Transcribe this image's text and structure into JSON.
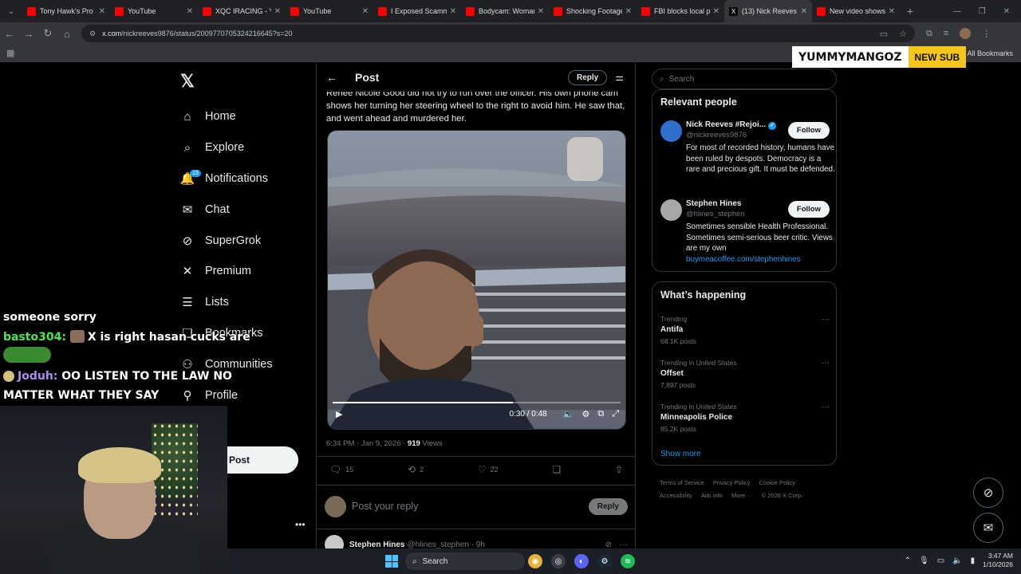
{
  "browser": {
    "tabs": [
      {
        "title": "Tony Hawk's Pro S",
        "icon": "youtube-icon"
      },
      {
        "title": "YouTube",
        "icon": "youtube-icon"
      },
      {
        "title": "XQC IRACING - Y",
        "icon": "youtube-icon"
      },
      {
        "title": "YouTube",
        "icon": "youtube-icon"
      },
      {
        "title": "I Exposed Scamm",
        "icon": "youtube-icon"
      },
      {
        "title": "Bodycam: Woman",
        "icon": "youtube-icon"
      },
      {
        "title": "Shocking Footage",
        "icon": "youtube-icon"
      },
      {
        "title": "FBI blocks local p",
        "icon": "youtube-icon"
      },
      {
        "title": "(13) Nick Reeves",
        "icon": "x-icon",
        "active": true
      },
      {
        "title": "New video shows",
        "icon": "youtube-icon"
      }
    ],
    "url_host": "x.com",
    "url_path": "/nickreeves9876/status/2009770705324216645?s=20",
    "all_bookmarks": "All Bookmarks"
  },
  "overlay": {
    "sub_name": "YUMMYMANGOZ",
    "sub_tag": "NEW SUB"
  },
  "nav": {
    "items": [
      {
        "label": "Home",
        "icon": "home-icon",
        "glyph": "⌂"
      },
      {
        "label": "Explore",
        "icon": "search-icon",
        "glyph": "⌕"
      },
      {
        "label": "Notifications",
        "icon": "bell-icon",
        "glyph": "🔔",
        "badge": "13"
      },
      {
        "label": "Chat",
        "icon": "mail-icon",
        "glyph": "✉"
      },
      {
        "label": "SuperGrok",
        "icon": "grok-icon",
        "glyph": "⊘"
      },
      {
        "label": "Premium",
        "icon": "x-icon",
        "glyph": "✕"
      },
      {
        "label": "Lists",
        "icon": "list-icon",
        "glyph": "☰"
      },
      {
        "label": "Bookmarks",
        "icon": "bookmark-icon",
        "glyph": "❏"
      },
      {
        "label": "Communities",
        "icon": "people-icon",
        "glyph": "⚇"
      },
      {
        "label": "Profile",
        "icon": "person-icon",
        "glyph": "⚲"
      }
    ],
    "post_label": "Post"
  },
  "post": {
    "header_title": "Post",
    "reply_label": "Reply",
    "text": "Renee Nicole Good did not try to run over the officer. His own phone cam shows her turning her steering wheel to the right to avoid him. He saw that, and went ahead and murdered her.",
    "video": {
      "time": "0:30 / 0:48",
      "progress": 0.625
    },
    "timestamp": "6:34 PM · Jan 9, 2026 · ",
    "views_count": "919",
    "views_label": " Views",
    "replies": "15",
    "reposts": "2",
    "likes": "22",
    "reply_placeholder": "Post your reply",
    "reply_button": "Reply",
    "next_reply": {
      "name": "Stephen Hines",
      "handle": "@hlines_stephen · 9h"
    }
  },
  "sidebar": {
    "search_placeholder": "Search",
    "relevant_title": "Relevant people",
    "people": [
      {
        "name": "Nick Reeves #Rejoi...",
        "handle": "@nickreeves9876",
        "bio": "For most of recorded history, humans have been ruled by despots. Democracy is a rare and precious gift. It must be defended.",
        "follow": "Follow",
        "verified": true
      },
      {
        "name": "Stephen Hines",
        "handle": "@hlines_stephen",
        "bio": "Sometimes sensible Health Professional. Sometimes semi-serious beer critic. Views are my own",
        "link": "buymeacoffee.com/stephenhines",
        "follow": "Follow"
      }
    ],
    "happening_title": "What’s happening",
    "trends": [
      {
        "context": "Trending",
        "title": "Antifa",
        "count": "68.1K posts"
      },
      {
        "context": "Trending in United States",
        "title": "Offset",
        "count": "7,897 posts"
      },
      {
        "context": "Trending in United States",
        "title": "Minneapolis Police",
        "count": "85.2K posts"
      }
    ],
    "show_more": "Show more",
    "footer": [
      "Terms of Service",
      "Privacy Policy",
      "Cookie Policy",
      "Accessibility",
      "Ads info",
      "More ···",
      "© 2026 X Corp."
    ]
  },
  "chat": {
    "line1": "someone sorry",
    "user2": "basto304:",
    "msg2": "X is right hasan cucks are",
    "user3": "Joduh:",
    "msg3": "OO LISTEN TO THE LAW NO MATTER WHAT THEY SAY"
  },
  "taskbar": {
    "search": "Search",
    "time": "3:47 AM",
    "date": "1/10/2026"
  }
}
